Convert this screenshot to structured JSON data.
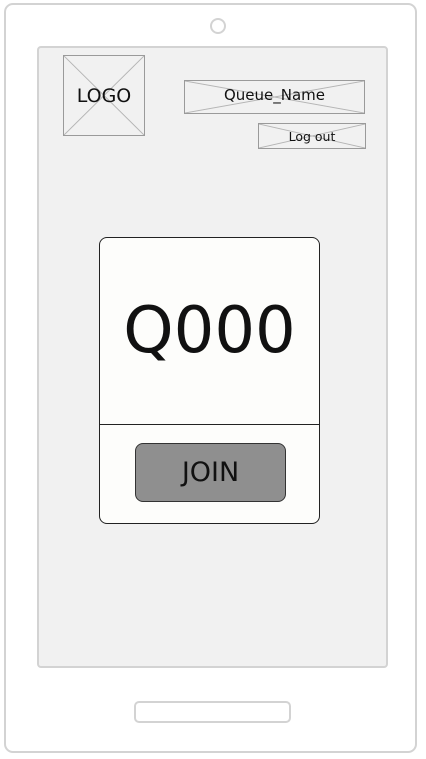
{
  "header": {
    "logo_label": "LOGO",
    "queue_name": "Queue_Name",
    "logout_label": "Log out"
  },
  "card": {
    "queue_number": "Q000",
    "join_label": "JOIN"
  },
  "colors": {
    "screen_background": "#f1f1f1",
    "device_border": "#d3d3d3",
    "join_button": "#8f8f8f",
    "card_background": "#fdfdfb"
  }
}
